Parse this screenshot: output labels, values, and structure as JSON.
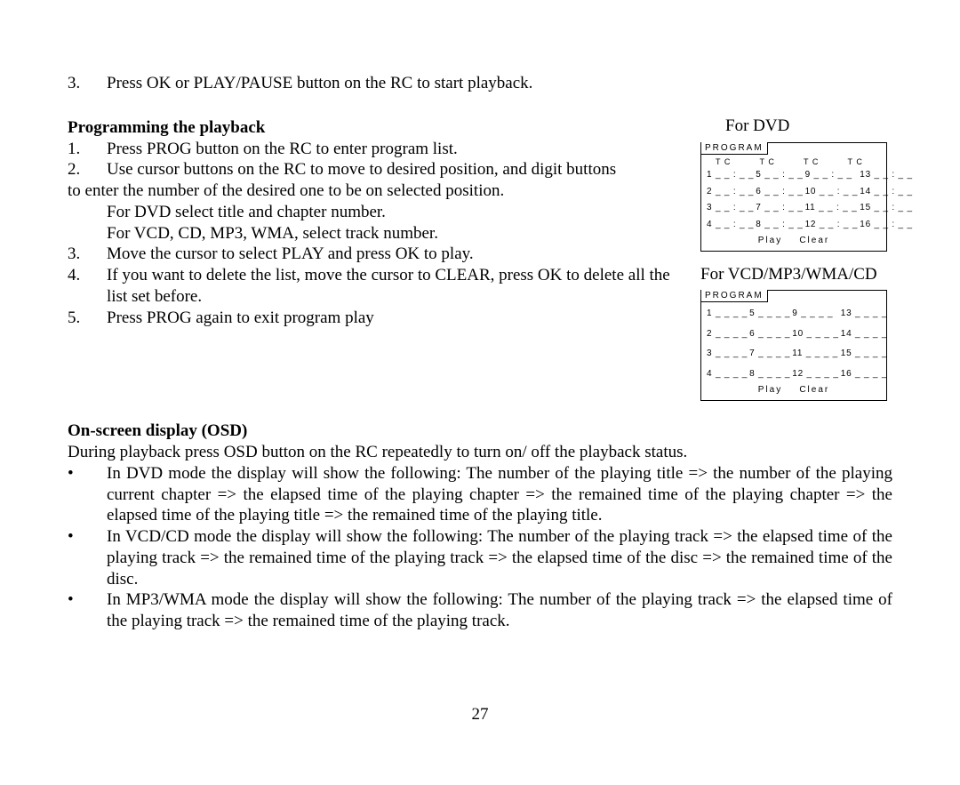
{
  "topline": {
    "num": "3.",
    "text": "Press OK or PLAY/PAUSE button on the RC to start playback."
  },
  "section1_title": "Programming the playback",
  "s1": {
    "i1": {
      "num": "1.",
      "text": "Press PROG button on the RC to enter program list."
    },
    "i2": {
      "num": "2.",
      "text": "Use cursor buttons on the RC to move to desired position, and digit buttons"
    },
    "i2_cont": "to enter the number of the desired one to be on selected position.",
    "i2_sub1": "For DVD select title and chapter number.",
    "i2_sub2": "For VCD, CD, MP3, WMA, select track number.",
    "i3": {
      "num": "3.",
      "text": "Move the cursor to select PLAY and press OK to play."
    },
    "i4": {
      "num": "4.",
      "text": "If you want to delete the list, move the cursor to CLEAR, press OK to delete all the list set before."
    },
    "i5": {
      "num": "5.",
      "text": "Press PROG again to exit program play"
    }
  },
  "section2_title": "On-screen display (OSD)",
  "section2_intro": "During playback press OSD button on the RC repeatedly to turn on/ off the playback status.",
  "s2": {
    "b1": "In DVD mode the display will show the following: The number of the playing title => the number of the playing current chapter => the elapsed time of the playing chapter => the remained time of the playing chapter => the elapsed time of the playing title => the remained time of the playing title.",
    "b2": "In VCD/CD mode the display will show the following: The number of the playing track => the elapsed time of the playing track => the remained time of the playing track => the elapsed time of the disc => the remained time of the disc.",
    "b3": "In MP3/WMA mode the display will show the following: The number of the playing track => the elapsed time of the playing track => the remained time of the playing track."
  },
  "page_number": "27",
  "fig": {
    "caption1": "For DVD",
    "caption2": "For VCD/MP3/WMA/CD",
    "tab": "PROGRAM",
    "hdr": "T   C",
    "footer_play": "Play",
    "footer_clear": "Clear",
    "dvd_rows": [
      [
        "1 _ _ : _ _",
        "5 _ _ : _ _",
        "9 _ _ : _ _",
        "13 _ _ : _ _"
      ],
      [
        "2 _ _ : _ _",
        "6 _ _ : _ _",
        "10 _ _ : _ _",
        "14 _ _ : _ _"
      ],
      [
        "3 _ _ : _ _",
        "7 _ _ : _ _",
        "11 _ _ : _ _",
        "15 _ _ : _ _"
      ],
      [
        "4 _ _ : _ _",
        "8 _ _ : _ _",
        "12 _ _ : _ _",
        "16 _ _ : _ _"
      ]
    ],
    "cd_rows": [
      [
        "1 _ _ _ _",
        "5 _ _ _ _",
        "9 _ _ _ _",
        "13 _ _ _ _"
      ],
      [
        "2 _ _ _ _",
        "6 _ _ _ _",
        "10 _ _ _ _",
        "14 _ _ _ _"
      ],
      [
        "3 _ _ _ _",
        "7 _ _ _ _",
        "11 _ _ _ _",
        "15 _ _ _ _"
      ],
      [
        "4 _ _ _ _",
        "8 _ _ _ _",
        "12 _ _ _ _",
        "16 _ _ _ _"
      ]
    ]
  }
}
